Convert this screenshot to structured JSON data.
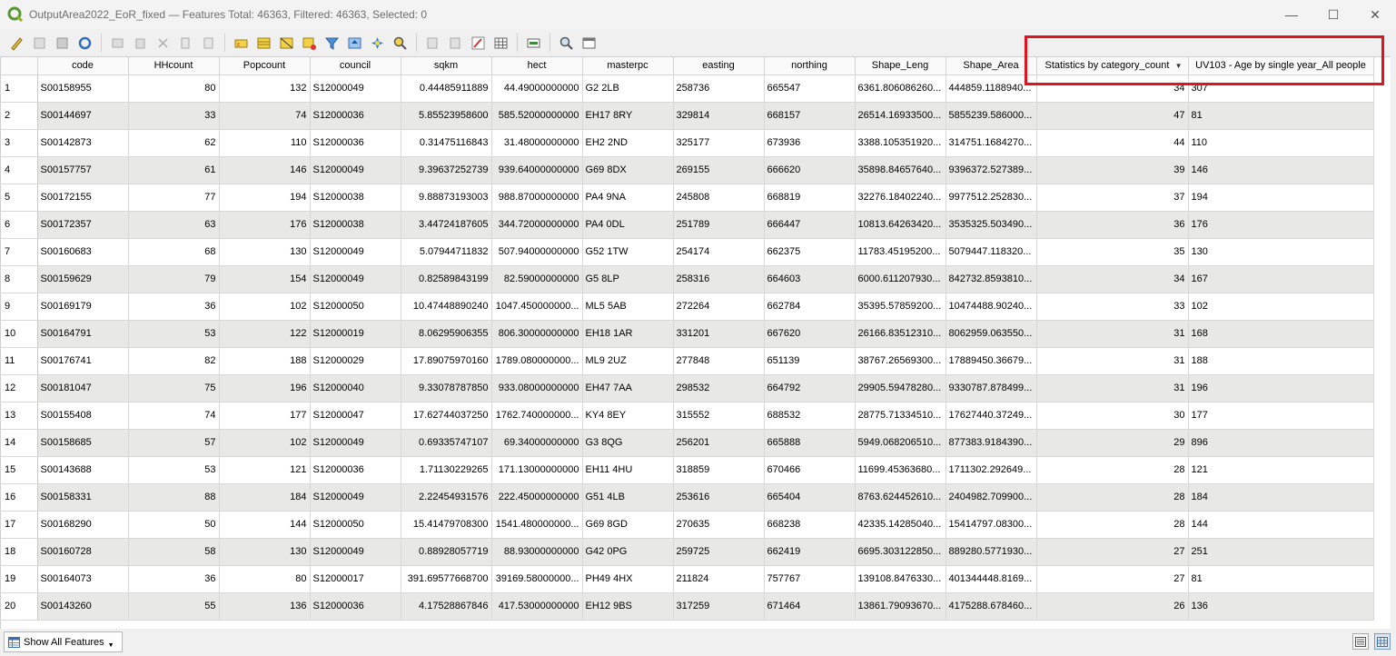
{
  "window": {
    "title": "OutputArea2022_EoR_fixed — Features Total: 46363, Filtered: 46363, Selected: 0",
    "minimize": "—",
    "maximize": "☐",
    "close": "✕"
  },
  "toolbar": {
    "icons": [
      "toggle-editing-icon",
      "multi-edit-icon",
      "save-edits-icon",
      "reload-icon",
      "add-feature-icon",
      "delete-feature-icon",
      "cut-icon",
      "copy-icon",
      "paste-icon",
      "select-by-expression-icon",
      "select-all-icon",
      "invert-selection-icon",
      "deselect-all-icon",
      "filter-select-icon",
      "move-selection-top-icon",
      "pan-to-selection-icon",
      "zoom-to-selection-icon",
      "new-field-icon",
      "delete-field-icon",
      "field-calculator-icon",
      "conditional-formatting-icon",
      "actions-icon",
      "dock-icon",
      "organize-columns-icon"
    ]
  },
  "table": {
    "columns": [
      "code",
      "HHcount",
      "Popcount",
      "council",
      "sqkm",
      "hect",
      "masterpc",
      "easting",
      "northing",
      "Shape_Leng",
      "Shape_Area",
      "Statistics by category_count",
      "UV103 - Age by single year_All people"
    ],
    "sorted_column": "Statistics by category_count",
    "rows": [
      [
        "1",
        "S00158955",
        "80",
        "132",
        "S12000049",
        "0.44485911889",
        "44.49000000000",
        "G2 2LB",
        "258736",
        "665547",
        "6361.806086260...",
        "444859.1188940...",
        "34",
        "307"
      ],
      [
        "2",
        "S00144697",
        "33",
        "74",
        "S12000036",
        "5.85523958600",
        "585.52000000000",
        "EH17 8RY",
        "329814",
        "668157",
        "26514.16933500...",
        "5855239.586000...",
        "47",
        "81"
      ],
      [
        "3",
        "S00142873",
        "62",
        "110",
        "S12000036",
        "0.31475116843",
        "31.48000000000",
        "EH2 2ND",
        "325177",
        "673936",
        "3388.105351920...",
        "314751.1684270...",
        "44",
        "110"
      ],
      [
        "4",
        "S00157757",
        "61",
        "146",
        "S12000049",
        "9.39637252739",
        "939.64000000000",
        "G69 8DX",
        "269155",
        "666620",
        "35898.84657640...",
        "9396372.527389...",
        "39",
        "146"
      ],
      [
        "5",
        "S00172155",
        "77",
        "194",
        "S12000038",
        "9.88873193003",
        "988.87000000000",
        "PA4 9NA",
        "245808",
        "668819",
        "32276.18402240...",
        "9977512.252830...",
        "37",
        "194"
      ],
      [
        "6",
        "S00172357",
        "63",
        "176",
        "S12000038",
        "3.44724187605",
        "344.72000000000",
        "PA4 0DL",
        "251789",
        "666447",
        "10813.64263420...",
        "3535325.503490...",
        "36",
        "176"
      ],
      [
        "7",
        "S00160683",
        "68",
        "130",
        "S12000049",
        "5.07944711832",
        "507.94000000000",
        "G52 1TW",
        "254174",
        "662375",
        "11783.45195200...",
        "5079447.118320...",
        "35",
        "130"
      ],
      [
        "8",
        "S00159629",
        "79",
        "154",
        "S12000049",
        "0.82589843199",
        "82.59000000000",
        "G5 8LP",
        "258316",
        "664603",
        "6000.611207930...",
        "842732.8593810...",
        "34",
        "167"
      ],
      [
        "9",
        "S00169179",
        "36",
        "102",
        "S12000050",
        "10.47448890240",
        "1047.450000000...",
        "ML5 5AB",
        "272264",
        "662784",
        "35395.57859200...",
        "10474488.90240...",
        "33",
        "102"
      ],
      [
        "10",
        "S00164791",
        "53",
        "122",
        "S12000019",
        "8.06295906355",
        "806.30000000000",
        "EH18 1AR",
        "331201",
        "667620",
        "26166.83512310...",
        "8062959.063550...",
        "31",
        "168"
      ],
      [
        "11",
        "S00176741",
        "82",
        "188",
        "S12000029",
        "17.89075970160",
        "1789.080000000...",
        "ML9 2UZ",
        "277848",
        "651139",
        "38767.26569300...",
        "17889450.36679...",
        "31",
        "188"
      ],
      [
        "12",
        "S00181047",
        "75",
        "196",
        "S12000040",
        "9.33078787850",
        "933.08000000000",
        "EH47 7AA",
        "298532",
        "664792",
        "29905.59478280...",
        "9330787.878499...",
        "31",
        "196"
      ],
      [
        "13",
        "S00155408",
        "74",
        "177",
        "S12000047",
        "17.62744037250",
        "1762.740000000...",
        "KY4 8EY",
        "315552",
        "688532",
        "28775.71334510...",
        "17627440.37249...",
        "30",
        "177"
      ],
      [
        "14",
        "S00158685",
        "57",
        "102",
        "S12000049",
        "0.69335747107",
        "69.34000000000",
        "G3 8QG",
        "256201",
        "665888",
        "5949.068206510...",
        "877383.9184390...",
        "29",
        "896"
      ],
      [
        "15",
        "S00143688",
        "53",
        "121",
        "S12000036",
        "1.71130229265",
        "171.13000000000",
        "EH11 4HU",
        "318859",
        "670466",
        "11699.45363680...",
        "1711302.292649...",
        "28",
        "121"
      ],
      [
        "16",
        "S00158331",
        "88",
        "184",
        "S12000049",
        "2.22454931576",
        "222.45000000000",
        "G51 4LB",
        "253616",
        "665404",
        "8763.624452610...",
        "2404982.709900...",
        "28",
        "184"
      ],
      [
        "17",
        "S00168290",
        "50",
        "144",
        "S12000050",
        "15.41479708300",
        "1541.480000000...",
        "G69 8GD",
        "270635",
        "668238",
        "42335.14285040...",
        "15414797.08300...",
        "28",
        "144"
      ],
      [
        "18",
        "S00160728",
        "58",
        "130",
        "S12000049",
        "0.88928057719",
        "88.93000000000",
        "G42 0PG",
        "259725",
        "662419",
        "6695.303122850...",
        "889280.5771930...",
        "27",
        "251"
      ],
      [
        "19",
        "S00164073",
        "36",
        "80",
        "S12000017",
        "391.69577668700",
        "39169.58000000...",
        "PH49 4HX",
        "211824",
        "757767",
        "139108.8476330...",
        "401344448.8169...",
        "27",
        "81"
      ],
      [
        "20",
        "S00143260",
        "55",
        "136",
        "S12000036",
        "4.17528867846",
        "417.53000000000",
        "EH12 9BS",
        "317259",
        "671464",
        "13861.79093670...",
        "4175288.678460...",
        "26",
        "136"
      ]
    ]
  },
  "bottom": {
    "show_all_label": "Show All Features"
  },
  "colors": {
    "highlight": "#e0141e",
    "alt_row": "#e8e8e6"
  }
}
